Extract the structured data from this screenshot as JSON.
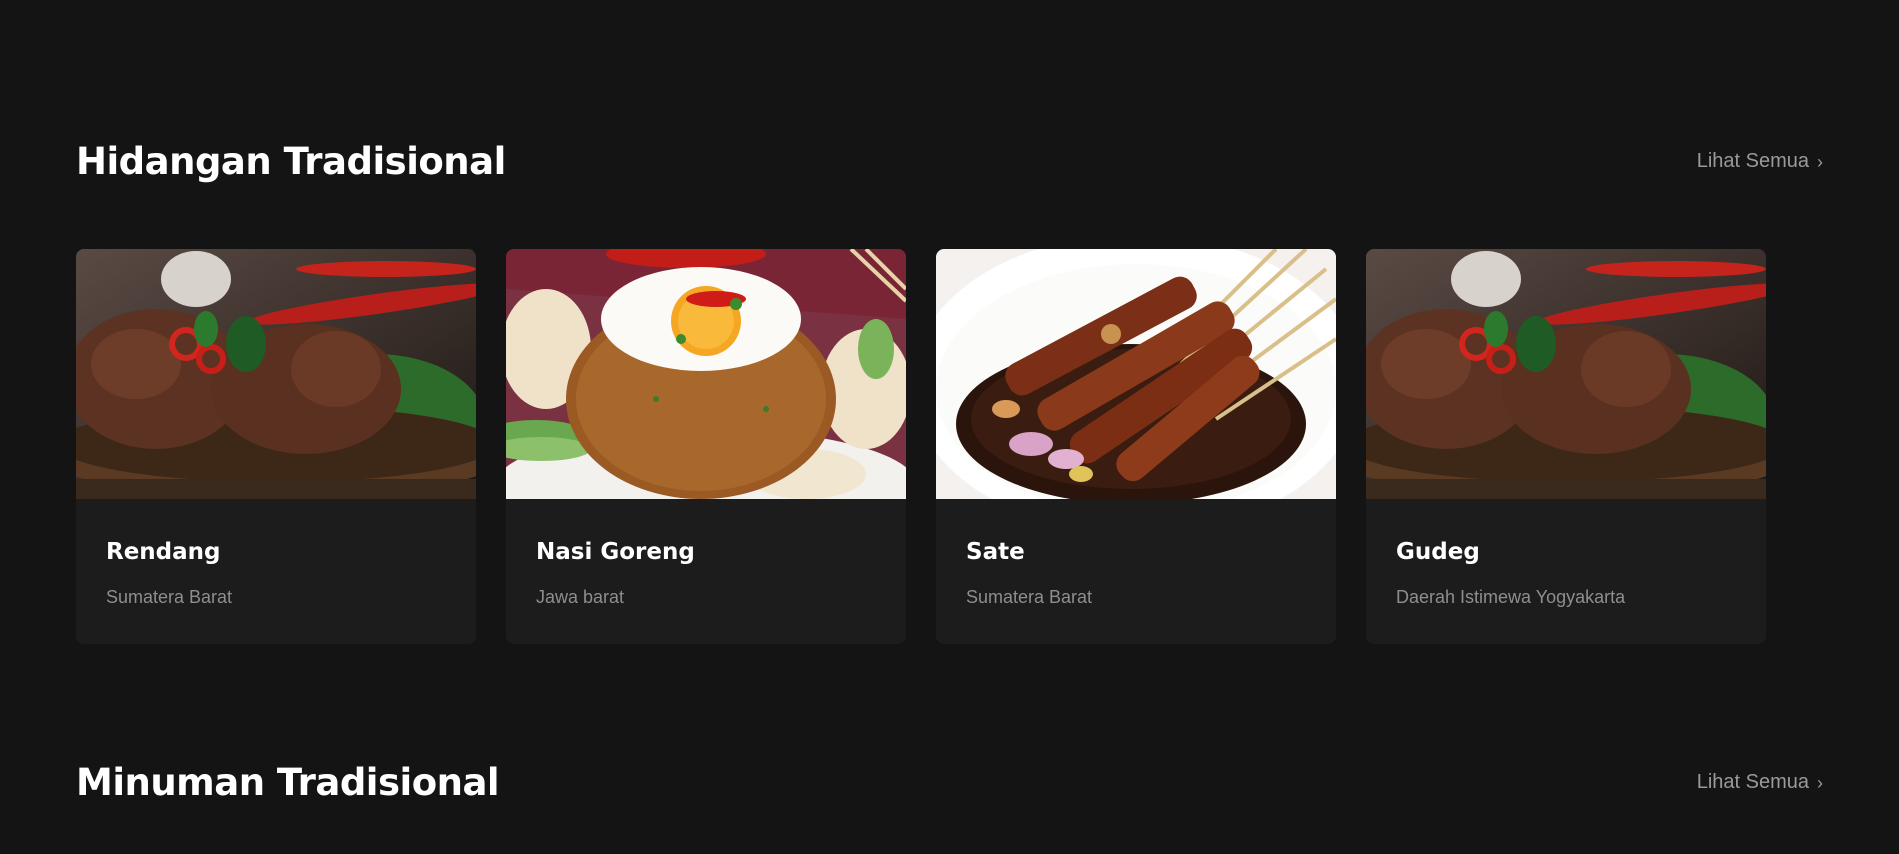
{
  "sections": [
    {
      "title": "Hidangan Tradisional",
      "see_all": "Lihat Semua",
      "items": [
        {
          "name": "Rendang",
          "region": "Sumatera Barat",
          "image": "rendang"
        },
        {
          "name": "Nasi Goreng",
          "region": "Jawa barat",
          "image": "nasi-goreng"
        },
        {
          "name": "Sate",
          "region": "Sumatera Barat",
          "image": "sate"
        },
        {
          "name": "Gudeg",
          "region": "Daerah Istimewa Yogyakarta",
          "image": "rendang"
        }
      ]
    },
    {
      "title": "Minuman Tradisional",
      "see_all": "Lihat Semua"
    }
  ],
  "icons": {
    "see_all": "chevron-right-icon"
  },
  "colors": {
    "background": "#141414",
    "card": "#1c1c1c",
    "muted_text": "#8e8e8e"
  }
}
